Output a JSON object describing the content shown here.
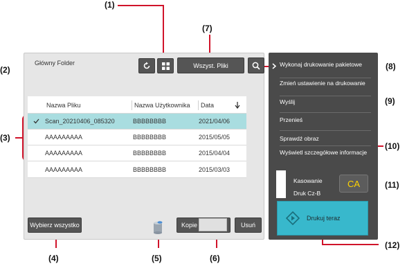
{
  "callouts": {
    "c1": "(1)",
    "c2": "(2)",
    "c3": "(3)",
    "c4": "(4)",
    "c5": "(5)",
    "c6": "(6)",
    "c7": "(7)",
    "c8": "(8)",
    "c9": "(9)",
    "c10": "(10)",
    "c11": "(11)",
    "c12": "(12)"
  },
  "toolbar": {
    "folder_label": "Główny Folder",
    "all_files_label": "Wszyst. Pliki"
  },
  "table": {
    "headers": [
      "Nazwa Pliku",
      "Nazwa Użytkownika",
      "Data"
    ],
    "rows": [
      [
        "Scan_20210406_085320",
        "BBBBBBBB",
        "2021/04/06"
      ],
      [
        "AAAAAAAAA",
        "BBBBBBBB",
        "2015/05/05"
      ],
      [
        "AAAAAAAAA",
        "BBBBBBBB",
        "2015/04/04"
      ],
      [
        "AAAAAAAAA",
        "BBBBBBBB",
        "2015/03/03"
      ]
    ]
  },
  "bottom": {
    "select_all": "Wybierz wszystko",
    "copies": "Kopie",
    "delete": "Usuń"
  },
  "side_menu": {
    "items": [
      "Wykonaj drukowanie pakietowe",
      "Zmień ustawienie na drukowanie",
      "Wyślij",
      "Przenieś",
      "Sprawdź obraz",
      "Wyświetl szczegółowe informacje"
    ]
  },
  "status": {
    "clear": "Kasowanie",
    "print_bw": "Druk Cz-B",
    "ca": "CA"
  },
  "print_now": "Drukuj teraz",
  "colors": {
    "accent": "#d0132a",
    "selected_row": "#a9dde0",
    "print_button": "#38b8cc",
    "ca_button": "#ffd400"
  }
}
